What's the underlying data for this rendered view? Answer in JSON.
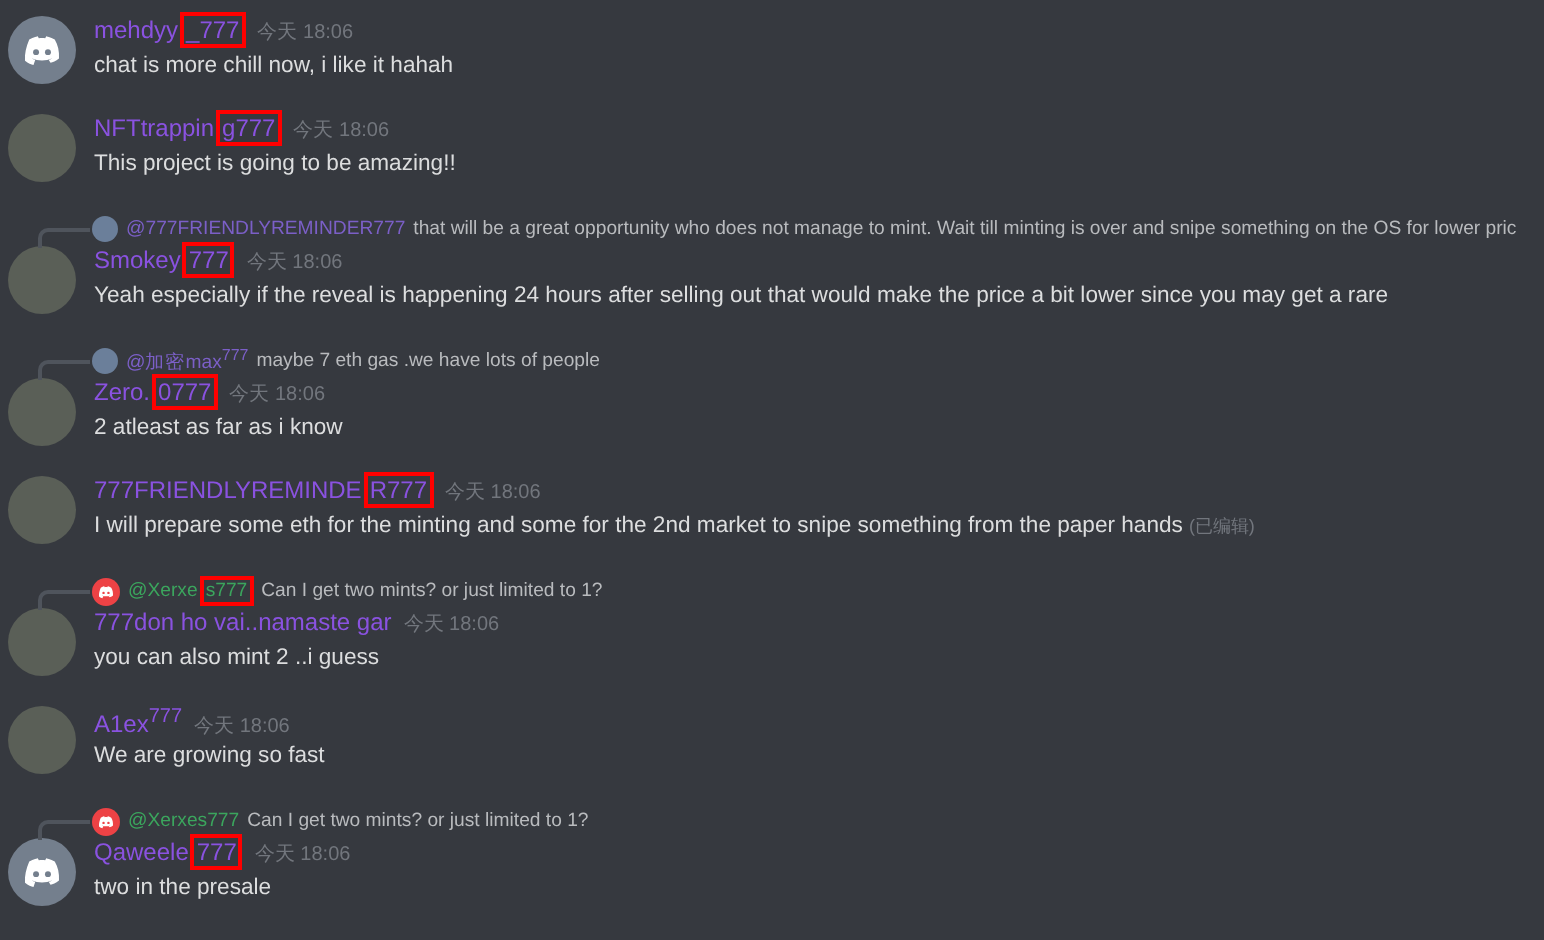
{
  "messages": [
    {
      "avatar": {
        "kind": "discord"
      },
      "author": {
        "name": "mehdyy",
        "marked": "_777"
      },
      "time": "今天 18:06",
      "text": "chat is more chill now, i like it hahah"
    },
    {
      "avatar": {
        "kind": "photo"
      },
      "author": {
        "name": "NFTtrappin",
        "marked": "g777"
      },
      "time": "今天 18:06",
      "text": "This project is going to be amazing!!"
    },
    {
      "avatar": {
        "kind": "photo"
      },
      "reply": {
        "avatar": {
          "kind": "photo"
        },
        "mention": "@777FRIENDLYREMINDER777",
        "color": "#7b5fc7",
        "text": "that will be a great opportunity who does not manage to mint. Wait till minting is over and snipe something on the OS for lower pric"
      },
      "author": {
        "name": "Smokey",
        "marked": "777"
      },
      "time": "今天 18:06",
      "text": "Yeah especially if the reveal is happening 24 hours after selling out that would make the price a bit lower since you may get a rare"
    },
    {
      "avatar": {
        "kind": "photo"
      },
      "reply": {
        "avatar": {
          "kind": "photo"
        },
        "mention": "@加密max$^{777}$",
        "color": "#7b5fc7",
        "text": "maybe 7 eth gas .we have lots of people"
      },
      "author": {
        "name": "Zero.",
        "marked": "0777"
      },
      "time": "今天 18:06",
      "text": "2 atleast as far as i know"
    },
    {
      "avatar": {
        "kind": "photo"
      },
      "author": {
        "name": "777FRIENDLYREMINDE",
        "marked": "R777"
      },
      "time": "今天 18:06",
      "text": "I will prepare some eth for the minting and some for the 2nd market to snipe something from the paper hands",
      "edited_label": "(已编辑)"
    },
    {
      "avatar": {
        "kind": "photo"
      },
      "reply": {
        "avatar": {
          "kind": "discord"
        },
        "mention": "@Xerxe",
        "mention_marked": "s777",
        "color": "#3ba55d",
        "text": "Can I get two mints? or just limited to 1?"
      },
      "author": {
        "name": "777don ho vai..namaste gar"
      },
      "time": "今天 18:06",
      "text": "you can also mint 2 ..i guess"
    },
    {
      "avatar": {
        "kind": "photo"
      },
      "author": {
        "name": "A1ex$^{777}$"
      },
      "time": "今天 18:06",
      "text": "We are growing so fast"
    },
    {
      "avatar": {
        "kind": "discord"
      },
      "reply": {
        "avatar": {
          "kind": "discord"
        },
        "mention": "@Xerxes777",
        "color": "#3ba55d",
        "text": "Can I get two mints? or just limited to 1?"
      },
      "author": {
        "name": "Qaweele",
        "marked": "777"
      },
      "time": "今天 18:06",
      "text": "two in the presale"
    }
  ]
}
